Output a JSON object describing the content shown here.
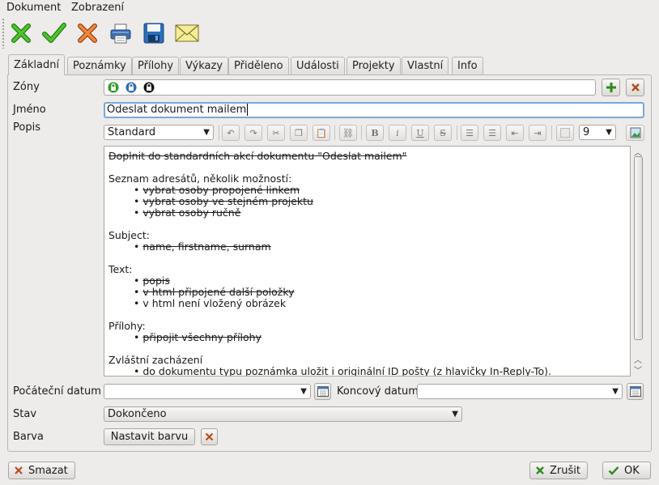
{
  "menu": [
    "Dokument",
    "Zobrazení"
  ],
  "toolbar": {
    "icons": [
      "close-green-icon",
      "check-green-icon",
      "close-orange-icon",
      "printer-icon",
      "floppy-icon",
      "envelope-icon"
    ]
  },
  "tabs": [
    "Základní",
    "Poznámky",
    "Přílohy",
    "Výkazy",
    "Přiděleno",
    "Události",
    "Projekty",
    "Vlastní",
    "Info"
  ],
  "form": {
    "zones_label": "Zóny",
    "name_label": "Jméno",
    "name_value": "Odeslat dokument mailem",
    "description_label": "Popis",
    "style_value": "Standard",
    "font_size_value": "9",
    "start_date_label": "Počáteční datum",
    "end_date_label": "Koncový datum",
    "status_label": "Stav",
    "status_value": "Dokončeno",
    "color_label": "Barva",
    "set_color_button": "Nastavit barvu"
  },
  "editor": {
    "line1": "Doplnit do standardních akcí dokumentu \"Odeslat mailem\"",
    "recipients_heading": "Seznam adresátů, několik možností:",
    "r1": "vybrat osoby propojené linkem",
    "r2": "vybrat osoby ve stejném projektu",
    "r3": "vybrat osoby ručně",
    "subject_heading": "Subject:",
    "s1": "name, firstname, surnam",
    "text_heading": "Text:",
    "t1": "popis",
    "t2": "v html připojené další položky",
    "t3": "v html není vložený obrázek",
    "attach_heading": "Přílohy:",
    "a1": "připojit všechny přílohy",
    "special_heading": "Zvláštní zacházení",
    "sp1": "do dokumentu typu poznámka uložit i originální ID pošty (z hlavičky In-Reply-To).",
    "bullet": "•"
  },
  "footer": {
    "delete_button": "Smazat",
    "cancel_button": "Zrušit",
    "ok_button": "OK"
  }
}
